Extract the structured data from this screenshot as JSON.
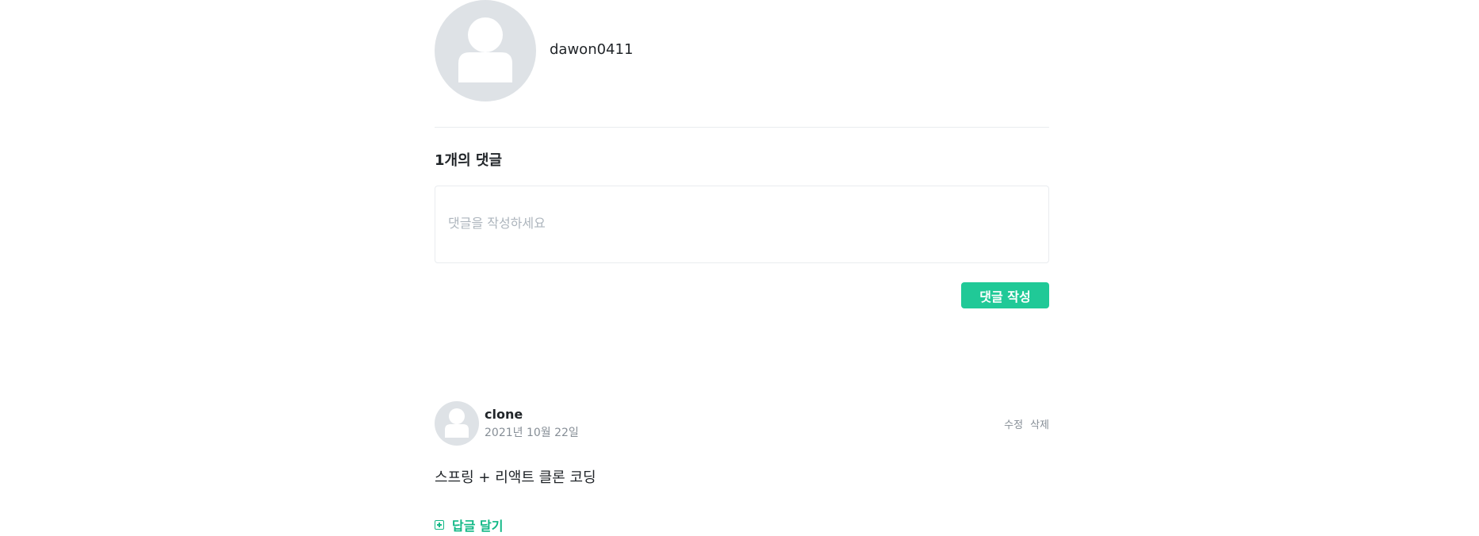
{
  "author": {
    "name": "dawon0411",
    "avatar_icon": "user-silhouette-icon"
  },
  "comments_section": {
    "count_label": "1개의 댓글",
    "input_placeholder": "댓글을 작성하세요",
    "input_value": "",
    "submit_label": "댓글 작성"
  },
  "comments": [
    {
      "username": "clone",
      "date": "2021년 10월 22일",
      "edit_label": "수정",
      "delete_label": "삭제",
      "body": "스프링 + 리액트 클론 코딩",
      "reply_label": "답글 달기",
      "reply_icon": "plus-square-icon"
    }
  ],
  "colors": {
    "accent": "#20c997",
    "reply_accent": "#12b886",
    "avatar_bg": "#dee2e6",
    "muted_text": "#868e96",
    "placeholder": "#adb5bd",
    "divider": "#e9ecef"
  }
}
